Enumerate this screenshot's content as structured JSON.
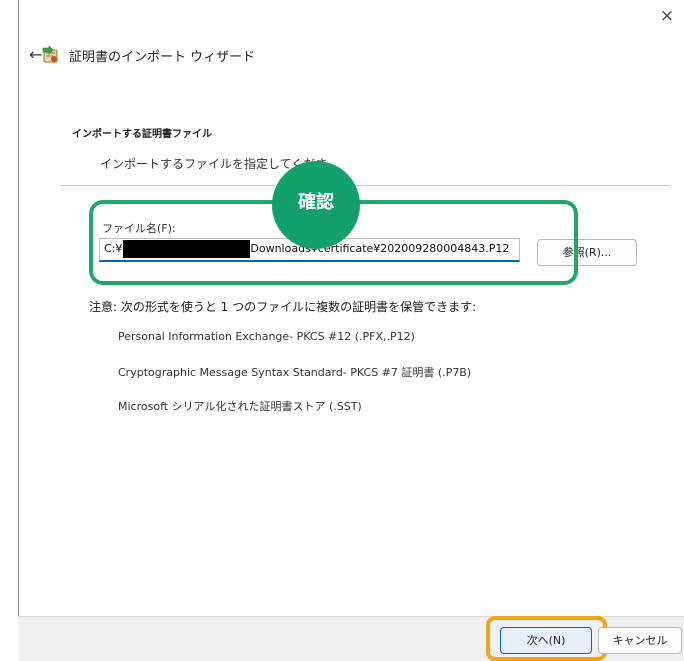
{
  "wizard": {
    "title": "証明書のインポート ウィザード",
    "close_glyph": "×",
    "back_glyph": "←",
    "icon": "certificate-import-icon"
  },
  "section": {
    "heading": "インポートする証明書ファイル",
    "description": "インポートするファイルを指定してくださ"
  },
  "file_field": {
    "label": "ファイル名(F):",
    "value_prefix": "C:¥",
    "value_suffix": "Downloads¥certificate¥202009280004843.P12"
  },
  "browse_button": {
    "label": "参照(R)..."
  },
  "annotation": {
    "badge_label": "確認",
    "confirm_color": "#1fa76c",
    "next_highlight_color": "#f2a51a"
  },
  "note": "注意: 次の形式を使うと 1 つのファイルに複数の証明書を保管できます:",
  "formats": [
    "Personal Information Exchange- PKCS #12 (.PFX,.P12)",
    "Cryptographic Message Syntax Standard- PKCS #7 証明書 (.P7B)",
    "Microsoft シリアル化された証明書ストア (.SST)"
  ],
  "footer": {
    "next_label": "次へ(N)",
    "cancel_label": "キャンセル"
  }
}
